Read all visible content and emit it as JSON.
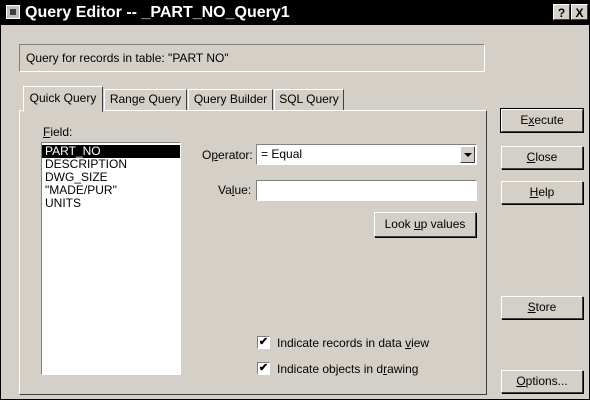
{
  "window": {
    "title": "Query Editor -- _PART_NO_Query1",
    "help_button": "?",
    "close_button": "X"
  },
  "info": {
    "text": "Query for records in table:  \"PART NO\""
  },
  "tabs": [
    {
      "label": "Quick Query",
      "active": true
    },
    {
      "label": "Range Query",
      "active": false
    },
    {
      "label": "Query Builder",
      "active": false
    },
    {
      "label": "SQL Query",
      "active": false
    }
  ],
  "quick_query": {
    "field_label_first": "F",
    "field_label_rest": "ield:",
    "fields": [
      "PART_NO",
      "DESCRIPTION",
      "DWG_SIZE",
      "\"MADE/PUR\"",
      "UNITS"
    ],
    "selected_field": "PART_NO",
    "operator_label_pre": "O",
    "operator_label_u": "p",
    "operator_label_post": "erator:",
    "operator_value": "=  Equal",
    "value_label_pre": "Va",
    "value_label_u": "l",
    "value_label_post": "ue:",
    "value_text": "",
    "lookup_pre": "Look ",
    "lookup_u": "u",
    "lookup_post": "p values",
    "indicate_records_pre": "Indicate records in data ",
    "indicate_records_u": "v",
    "indicate_records_post": "iew",
    "indicate_records_checked": true,
    "indicate_objects_pre": "Indicate objects in d",
    "indicate_objects_u": "r",
    "indicate_objects_post": "awing",
    "indicate_objects_checked": true
  },
  "side_buttons": {
    "execute_pre": "E",
    "execute_u": "x",
    "execute_post": "ecute",
    "close_u": "C",
    "close_post": "lose",
    "help_u": "H",
    "help_post": "elp",
    "store_u": "S",
    "store_post": "tore",
    "options_u": "O",
    "options_post": "ptions..."
  },
  "check_mark": "✔"
}
